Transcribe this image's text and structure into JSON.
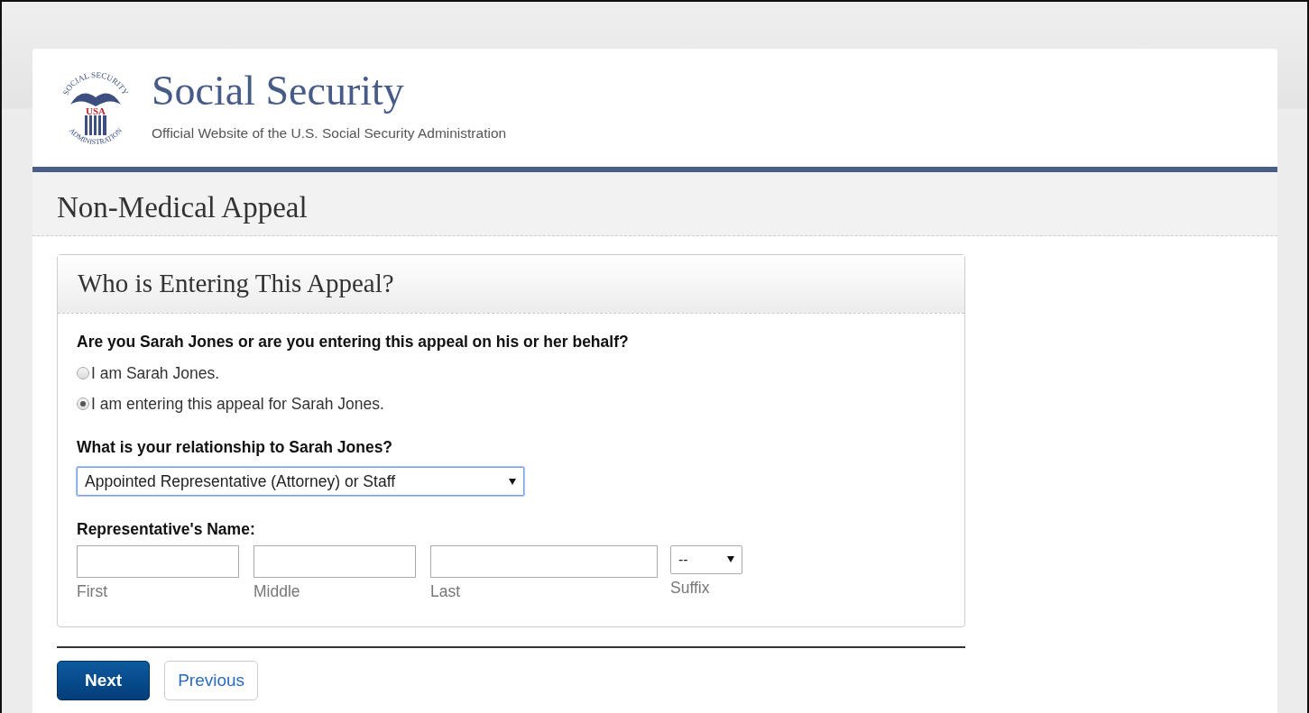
{
  "header": {
    "logo": {
      "top_text": "SOCIAL SECURITY",
      "badge": "USA",
      "bottom_text": "ADMINISTRATION"
    },
    "title": "Social Security",
    "subtitle": "Official Website of the U.S. Social Security Administration"
  },
  "page_title": "Non-Medical Appeal",
  "panel": {
    "title": "Who is Entering This Appeal?",
    "question": "Are you Sarah Jones or are you entering this appeal on his or her behalf?",
    "options": [
      {
        "label": "I am Sarah Jones.",
        "selected": false
      },
      {
        "label": "I am entering this appeal for Sarah Jones.",
        "selected": true
      }
    ],
    "relationship": {
      "label": "What is your relationship to Sarah Jones?",
      "value": "Appointed Representative (Attorney) or Staff"
    },
    "name": {
      "label": "Representative's Name:",
      "fields": [
        {
          "kind": "text",
          "caption": "First"
        },
        {
          "kind": "text",
          "caption": "Middle"
        },
        {
          "kind": "text",
          "caption": "Last"
        },
        {
          "kind": "select",
          "caption": "Suffix",
          "value": "--"
        }
      ]
    }
  },
  "buttons": [
    {
      "label": "Next",
      "kind": "primary"
    },
    {
      "label": "Previous",
      "kind": "secondary"
    }
  ]
}
